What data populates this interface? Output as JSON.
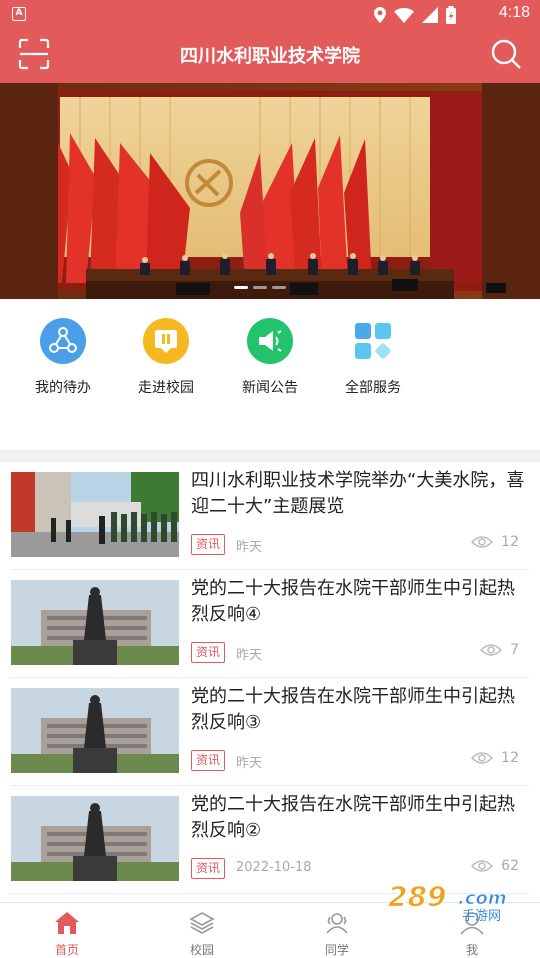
{
  "status_bar": {
    "time": "4:18"
  },
  "header": {
    "title": "四川水利职业技术学院",
    "scan_icon": "scan-icon",
    "search_icon": "search-icon"
  },
  "banner": {
    "pages": 3,
    "active_page": 1
  },
  "quick_entries": [
    {
      "label": "我的待办",
      "icon": "share-nodes-icon",
      "color": "#4a9fe8"
    },
    {
      "label": "走进校园",
      "icon": "book-icon",
      "color": "#f5b820"
    },
    {
      "label": "新闻公告",
      "icon": "speaker-icon",
      "color": "#22c36a"
    },
    {
      "label": "全部服务",
      "icon": "grid-icon",
      "color": "#5ab6ef"
    }
  ],
  "news": [
    {
      "title": "四川水利职业技术学院举办“大美水院，喜迎二十大”主题展览",
      "tag": "资讯",
      "date": "昨天",
      "views": "12"
    },
    {
      "title": "党的二十大报告在水院干部师生中引起热烈反响④",
      "tag": "资讯",
      "date": "昨天",
      "views": "7"
    },
    {
      "title": "党的二十大报告在水院干部师生中引起热烈反响③",
      "tag": "资讯",
      "date": "昨天",
      "views": "12"
    },
    {
      "title": "党的二十大报告在水院干部师生中引起热烈反响②",
      "tag": "资讯",
      "date": "2022-10-18",
      "views": "62"
    }
  ],
  "bottom_nav": [
    {
      "label": "首页",
      "icon": "home-icon",
      "active": true
    },
    {
      "label": "校园",
      "icon": "layers-icon",
      "active": false
    },
    {
      "label": "同学",
      "icon": "classmates-icon",
      "active": false
    },
    {
      "label": "我",
      "icon": "user-icon",
      "active": false
    }
  ],
  "watermark": {
    "text": "289.com",
    "subtext": "手游网"
  },
  "colors": {
    "brand": "#e25a59",
    "muted": "#aaaaaa"
  }
}
